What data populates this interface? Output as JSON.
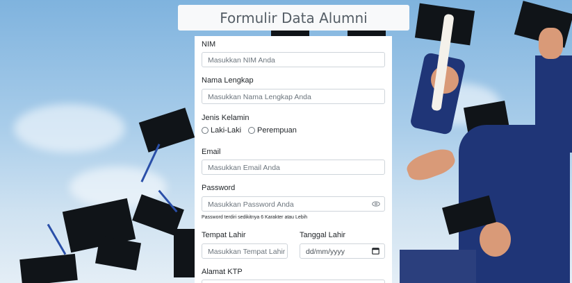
{
  "header": {
    "title": "Formulir Data Alumni"
  },
  "form": {
    "nim": {
      "label": "NIM",
      "placeholder": "Masukkan NIM Anda"
    },
    "nama": {
      "label": "Nama Lengkap",
      "placeholder": "Masukkan Nama Lengkap Anda"
    },
    "gender": {
      "label": "Jenis Kelamin",
      "options": [
        "Laki-Laki",
        "Perempuan"
      ]
    },
    "email": {
      "label": "Email",
      "placeholder": "Masukkan Email Anda"
    },
    "password": {
      "label": "Password",
      "placeholder": "Masukkan Password Anda",
      "hint": "Password terdiri sedikitnya 6 Karakter atau Lebih"
    },
    "tempat_lahir": {
      "label": "Tempat Lahir",
      "placeholder": "Masukkan Tempat Lahir"
    },
    "tanggal_lahir": {
      "label": "Tanggal Lahir",
      "placeholder": "dd/mm/yyyy"
    },
    "alamat": {
      "label": "Alamat KTP"
    }
  },
  "icons": {
    "password_toggle": "eye-icon",
    "date_picker": "calendar-icon"
  }
}
